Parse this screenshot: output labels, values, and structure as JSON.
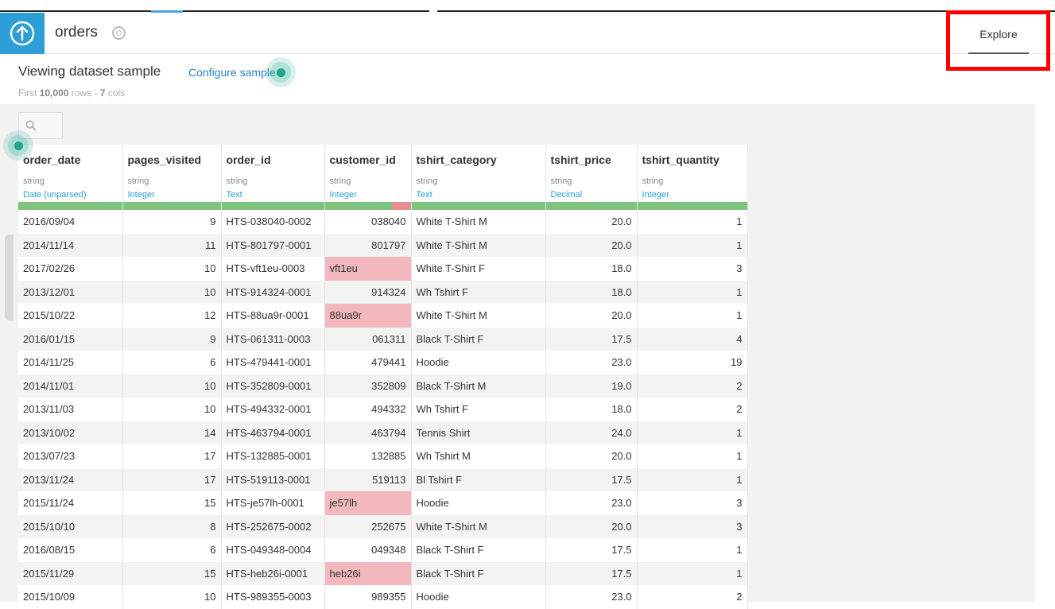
{
  "header": {
    "dataset_name": "orders",
    "explore_tab": "Explore"
  },
  "info": {
    "title": "Viewing dataset sample",
    "configure_link": "Configure sample",
    "rows_prefix": "First ",
    "rows_count": "10,000",
    "rows_mid": " rows - ",
    "cols_count": "7",
    "cols_suffix": " cols"
  },
  "icons": {
    "app": "upload-arrow-icon",
    "badge": "dataset-badge-icon",
    "search": "search-icon"
  },
  "colors": {
    "accent": "#2e9ed6",
    "valid": "#7ec47e",
    "invalid": "#e98c95",
    "invalid_cell": "#f2b8be",
    "highlight": "#ff0000"
  },
  "columns": [
    {
      "name": "order_date",
      "type": "string",
      "meaning": "Date (unparsed)",
      "invalid_ratio": 0
    },
    {
      "name": "pages_visited",
      "type": "string",
      "meaning": "Integer",
      "invalid_ratio": 0
    },
    {
      "name": "order_id",
      "type": "string",
      "meaning": "Text",
      "invalid_ratio": 0
    },
    {
      "name": "customer_id",
      "type": "string",
      "meaning": "Integer",
      "invalid_ratio": 0.22
    },
    {
      "name": "tshirt_category",
      "type": "string",
      "meaning": "Text",
      "invalid_ratio": 0
    },
    {
      "name": "tshirt_price",
      "type": "string",
      "meaning": "Decimal",
      "invalid_ratio": 0
    },
    {
      "name": "tshirt_quantity",
      "type": "string",
      "meaning": "Integer",
      "invalid_ratio": 0
    }
  ],
  "rows": [
    [
      "2016/09/04",
      "9",
      "HTS-038040-0002",
      "038040",
      "White T-Shirt M",
      "20.0",
      "1"
    ],
    [
      "2014/11/14",
      "11",
      "HTS-801797-0001",
      "801797",
      "White T-Shirt M",
      "20.0",
      "1"
    ],
    [
      "2017/02/26",
      "10",
      "HTS-vft1eu-0003",
      "vft1eu",
      "White T-Shirt F",
      "18.0",
      "3"
    ],
    [
      "2013/12/01",
      "10",
      "HTS-914324-0001",
      "914324",
      "Wh Tshirt F",
      "18.0",
      "1"
    ],
    [
      "2015/10/22",
      "12",
      "HTS-88ua9r-0001",
      "88ua9r",
      "White T-Shirt M",
      "20.0",
      "1"
    ],
    [
      "2016/01/15",
      "9",
      "HTS-061311-0003",
      "061311",
      "Black T-Shirt F",
      "17.5",
      "4"
    ],
    [
      "2014/11/25",
      "6",
      "HTS-479441-0001",
      "479441",
      "Hoodie",
      "23.0",
      "19"
    ],
    [
      "2014/11/01",
      "10",
      "HTS-352809-0001",
      "352809",
      "Black T-Shirt M",
      "19.0",
      "2"
    ],
    [
      "2013/11/03",
      "10",
      "HTS-494332-0001",
      "494332",
      "Wh Tshirt F",
      "18.0",
      "2"
    ],
    [
      "2013/10/02",
      "14",
      "HTS-463794-0001",
      "463794",
      "Tennis Shirt",
      "24.0",
      "1"
    ],
    [
      "2013/07/23",
      "17",
      "HTS-132885-0001",
      "132885",
      "Wh Tshirt M",
      "20.0",
      "1"
    ],
    [
      "2013/11/24",
      "17",
      "HTS-519113-0001",
      "519113",
      "Bl Tshirt F",
      "17.5",
      "1"
    ],
    [
      "2015/11/24",
      "15",
      "HTS-je57lh-0001",
      "je57lh",
      "Hoodie",
      "23.0",
      "3"
    ],
    [
      "2015/10/10",
      "8",
      "HTS-252675-0002",
      "252675",
      "White T-Shirt M",
      "20.0",
      "3"
    ],
    [
      "2016/08/15",
      "6",
      "HTS-049348-0004",
      "049348",
      "Black T-Shirt F",
      "17.5",
      "1"
    ],
    [
      "2015/11/29",
      "15",
      "HTS-heb26i-0001",
      "heb26i",
      "Black T-Shirt F",
      "17.5",
      "1"
    ],
    [
      "2015/10/09",
      "10",
      "HTS-989355-0003",
      "989355",
      "Hoodie",
      "23.0",
      "2"
    ]
  ],
  "invalid_cells": [
    [
      2,
      3
    ],
    [
      4,
      3
    ],
    [
      12,
      3
    ],
    [
      15,
      3
    ]
  ]
}
